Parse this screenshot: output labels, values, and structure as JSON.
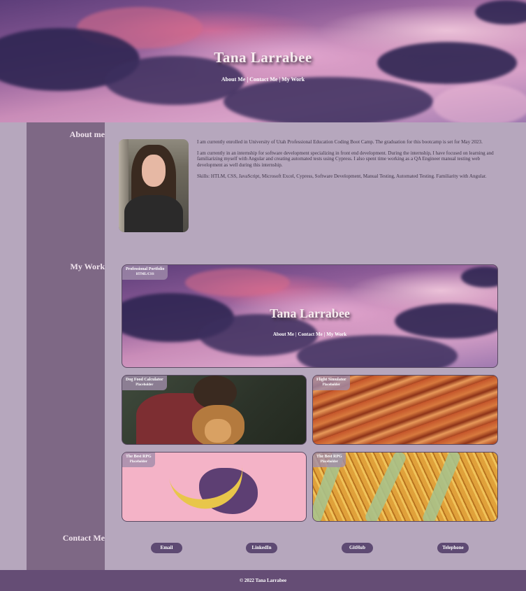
{
  "header": {
    "title": "Tana Larrabee",
    "nav": [
      "About Me",
      "Contact Me",
      "My Work"
    ],
    "separator": "|"
  },
  "sections": {
    "about": "About me",
    "work": "My Work",
    "contact": "Contact Me"
  },
  "about": {
    "paragraphs": [
      "I am currently enrolled in University of Utah Professional Education Coding Boot Camp. The graduation for this bootcamp is set for May 2023.",
      "I am currently in an internship for software development specializing in front end development. During the internship, I have focused on learning and familiarizing myself with Angular and creating automated tests using Cypress. I also spent time working as a QA Engineer manual testing web development as well during this internship.",
      "Skills: HTLM, CSS, JavaScript, Microsoft Excel, Cypress, Software Development, Manual Testing, Automated Testing. Familiarity with Angular."
    ]
  },
  "work": {
    "featured": {
      "title": "Professional Portfolio",
      "subtitle": "HTML/CSS",
      "preview_title": "Tana Larrabee",
      "preview_nav": [
        "About Me",
        "Contact Me",
        "My Work"
      ]
    },
    "cards": [
      {
        "title": "Dog Food Calculator",
        "subtitle": "Placeholder"
      },
      {
        "title": "Flight Simulator",
        "subtitle": "Placeholder"
      },
      {
        "title": "The Best RPG",
        "subtitle": "Placeholder"
      },
      {
        "title": "The Best RPG",
        "subtitle": "Placeholder"
      }
    ]
  },
  "contact": {
    "buttons": [
      "Email",
      "LinkedIn",
      "GitHub",
      "Telephone"
    ]
  },
  "footer": {
    "copyright": "© 2022 Tana Larrabee"
  },
  "colors": {
    "background": "#b6a7bd",
    "sidebar": "#7e6885",
    "button": "#5e4a73",
    "footer": "#654d75"
  }
}
